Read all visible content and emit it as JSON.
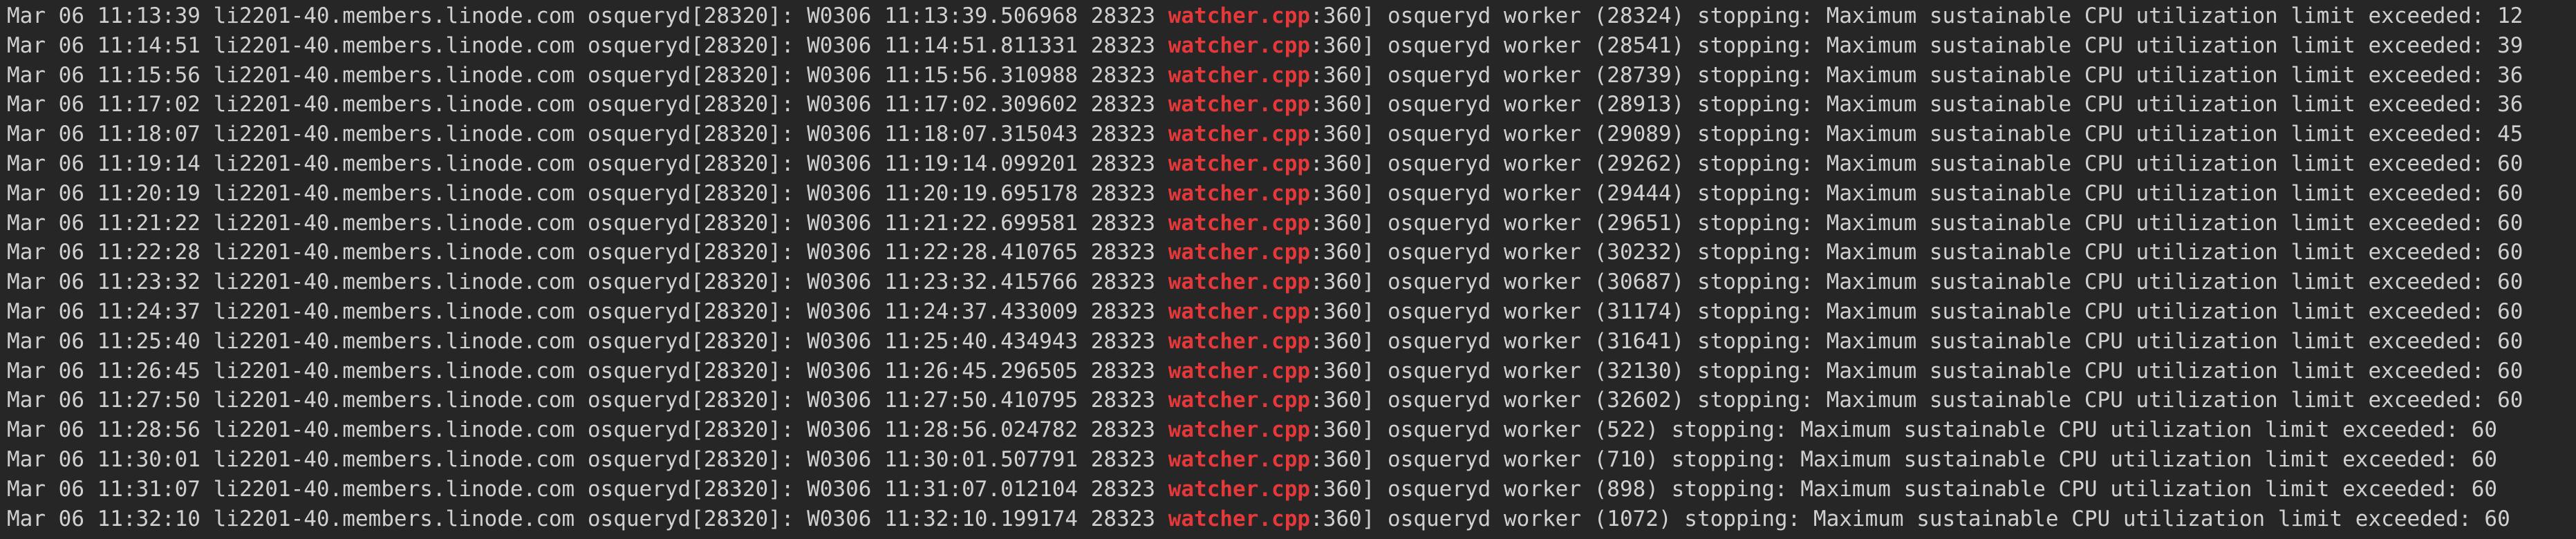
{
  "terminal": {
    "highlight_color": "#e5383b",
    "text_color": "#d0d0d0",
    "background_color": "#262626",
    "lines": [
      {
        "pre": "Mar 06 11:13:39 li2201-40.members.linode.com osqueryd[28320]: W0306 11:13:39.506968 28323 ",
        "file": "watcher.cpp",
        "post": ":360] osqueryd worker (28324) stopping: Maximum sustainable CPU utilization limit exceeded: 12"
      },
      {
        "pre": "Mar 06 11:14:51 li2201-40.members.linode.com osqueryd[28320]: W0306 11:14:51.811331 28323 ",
        "file": "watcher.cpp",
        "post": ":360] osqueryd worker (28541) stopping: Maximum sustainable CPU utilization limit exceeded: 39"
      },
      {
        "pre": "Mar 06 11:15:56 li2201-40.members.linode.com osqueryd[28320]: W0306 11:15:56.310988 28323 ",
        "file": "watcher.cpp",
        "post": ":360] osqueryd worker (28739) stopping: Maximum sustainable CPU utilization limit exceeded: 36"
      },
      {
        "pre": "Mar 06 11:17:02 li2201-40.members.linode.com osqueryd[28320]: W0306 11:17:02.309602 28323 ",
        "file": "watcher.cpp",
        "post": ":360] osqueryd worker (28913) stopping: Maximum sustainable CPU utilization limit exceeded: 36"
      },
      {
        "pre": "Mar 06 11:18:07 li2201-40.members.linode.com osqueryd[28320]: W0306 11:18:07.315043 28323 ",
        "file": "watcher.cpp",
        "post": ":360] osqueryd worker (29089) stopping: Maximum sustainable CPU utilization limit exceeded: 45"
      },
      {
        "pre": "Mar 06 11:19:14 li2201-40.members.linode.com osqueryd[28320]: W0306 11:19:14.099201 28323 ",
        "file": "watcher.cpp",
        "post": ":360] osqueryd worker (29262) stopping: Maximum sustainable CPU utilization limit exceeded: 60"
      },
      {
        "pre": "Mar 06 11:20:19 li2201-40.members.linode.com osqueryd[28320]: W0306 11:20:19.695178 28323 ",
        "file": "watcher.cpp",
        "post": ":360] osqueryd worker (29444) stopping: Maximum sustainable CPU utilization limit exceeded: 60"
      },
      {
        "pre": "Mar 06 11:21:22 li2201-40.members.linode.com osqueryd[28320]: W0306 11:21:22.699581 28323 ",
        "file": "watcher.cpp",
        "post": ":360] osqueryd worker (29651) stopping: Maximum sustainable CPU utilization limit exceeded: 60"
      },
      {
        "pre": "Mar 06 11:22:28 li2201-40.members.linode.com osqueryd[28320]: W0306 11:22:28.410765 28323 ",
        "file": "watcher.cpp",
        "post": ":360] osqueryd worker (30232) stopping: Maximum sustainable CPU utilization limit exceeded: 60"
      },
      {
        "pre": "Mar 06 11:23:32 li2201-40.members.linode.com osqueryd[28320]: W0306 11:23:32.415766 28323 ",
        "file": "watcher.cpp",
        "post": ":360] osqueryd worker (30687) stopping: Maximum sustainable CPU utilization limit exceeded: 60"
      },
      {
        "pre": "Mar 06 11:24:37 li2201-40.members.linode.com osqueryd[28320]: W0306 11:24:37.433009 28323 ",
        "file": "watcher.cpp",
        "post": ":360] osqueryd worker (31174) stopping: Maximum sustainable CPU utilization limit exceeded: 60"
      },
      {
        "pre": "Mar 06 11:25:40 li2201-40.members.linode.com osqueryd[28320]: W0306 11:25:40.434943 28323 ",
        "file": "watcher.cpp",
        "post": ":360] osqueryd worker (31641) stopping: Maximum sustainable CPU utilization limit exceeded: 60"
      },
      {
        "pre": "Mar 06 11:26:45 li2201-40.members.linode.com osqueryd[28320]: W0306 11:26:45.296505 28323 ",
        "file": "watcher.cpp",
        "post": ":360] osqueryd worker (32130) stopping: Maximum sustainable CPU utilization limit exceeded: 60"
      },
      {
        "pre": "Mar 06 11:27:50 li2201-40.members.linode.com osqueryd[28320]: W0306 11:27:50.410795 28323 ",
        "file": "watcher.cpp",
        "post": ":360] osqueryd worker (32602) stopping: Maximum sustainable CPU utilization limit exceeded: 60"
      },
      {
        "pre": "Mar 06 11:28:56 li2201-40.members.linode.com osqueryd[28320]: W0306 11:28:56.024782 28323 ",
        "file": "watcher.cpp",
        "post": ":360] osqueryd worker (522) stopping: Maximum sustainable CPU utilization limit exceeded: 60"
      },
      {
        "pre": "Mar 06 11:30:01 li2201-40.members.linode.com osqueryd[28320]: W0306 11:30:01.507791 28323 ",
        "file": "watcher.cpp",
        "post": ":360] osqueryd worker (710) stopping: Maximum sustainable CPU utilization limit exceeded: 60"
      },
      {
        "pre": "Mar 06 11:31:07 li2201-40.members.linode.com osqueryd[28320]: W0306 11:31:07.012104 28323 ",
        "file": "watcher.cpp",
        "post": ":360] osqueryd worker (898) stopping: Maximum sustainable CPU utilization limit exceeded: 60"
      },
      {
        "pre": "Mar 06 11:32:10 li2201-40.members.linode.com osqueryd[28320]: W0306 11:32:10.199174 28323 ",
        "file": "watcher.cpp",
        "post": ":360] osqueryd worker (1072) stopping: Maximum sustainable CPU utilization limit exceeded: 60"
      }
    ]
  }
}
